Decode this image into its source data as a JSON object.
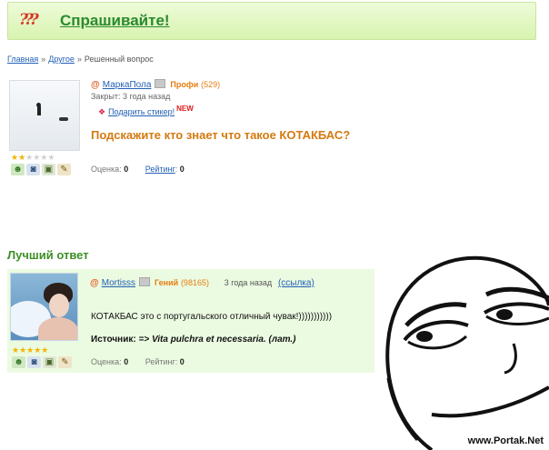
{
  "header": {
    "logo_text": "???",
    "title": "Спрашивайте!"
  },
  "breadcrumb": {
    "items": [
      "Главная",
      "Другое"
    ],
    "current": "Решенный вопрос",
    "separator": "»"
  },
  "question": {
    "user": {
      "at": "@",
      "name": "МаркаПола",
      "rank": "Профи",
      "points": "(529)"
    },
    "closed": "Закрыт: 3 года назад",
    "gift_link": "Подарить стикер!",
    "gift_new": "NEW",
    "title": "Подскажите кто знает что такое КОТАКБАС?",
    "rating_label": "Оценка:",
    "rating_value": "0",
    "ranking_label": "Рейтинг",
    "ranking_value": "0",
    "stars_on": 2
  },
  "best_answer": {
    "label": "Лучший ответ",
    "user": {
      "at": "@",
      "name": "Mortisss",
      "rank": "Гений",
      "points": "(98165)"
    },
    "time": "3 года назад",
    "link_text": "(ссылка)",
    "text": "КОТАКБАС это с португальского отличный чувак!)))))))))))",
    "source_label": "Источник:",
    "source_value": "=> Vita pulchra et necessaria. (лат.)",
    "rating_label": "Оценка:",
    "rating_value": "0",
    "ranking_label": "Рейтинг:",
    "ranking_value": "0",
    "stars_on": 5
  },
  "watermark": "www.Portak.Net",
  "colors": {
    "accent_green": "#2a8a2f",
    "orange": "#d47a10",
    "link": "#2260b5"
  },
  "icons": [
    "person-add-icon",
    "camera-icon",
    "video-icon",
    "pencil-icon"
  ]
}
